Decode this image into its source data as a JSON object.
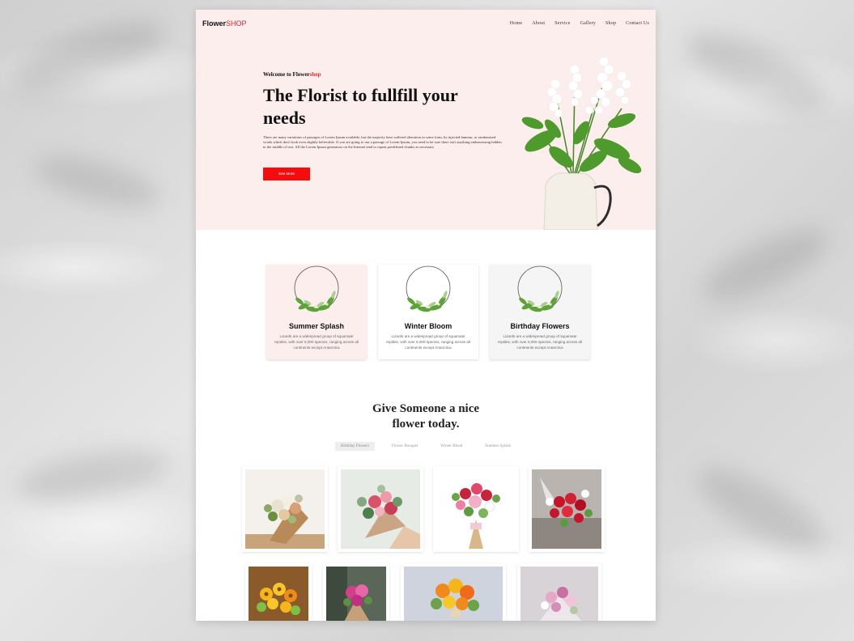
{
  "brand": {
    "name_black": "Flower",
    "name_red": "SHOP"
  },
  "nav": [
    "Home",
    "About",
    "Service",
    "Gallery",
    "Shop",
    "Contact Us"
  ],
  "hero": {
    "welcome_black": "Welcome to Flower",
    "welcome_red": "shop",
    "headline": "The Florist to fullfill your needs",
    "body": "There are many variations of passages of Lorem Ipsum available, but the majority have suffered alteration in some form, by injected humour, or randomised words which don't look even slightly believable. If you are going to use a passage of Lorem Ipsum, you need to be sure there isn't anything embarrassing hidden in the middle of text. All the Lorem Ipsum generators on the Internet tend to repeat predefined chunks as necessary",
    "button": "See More"
  },
  "features": [
    {
      "title": "Summer Splash",
      "text": "Lizards are a widespread group of squamate reptiles, with over 6,000 species, ranging across all continents except Antarctica"
    },
    {
      "title": "Winter Bloom",
      "text": "Lizards are a widespread group of squamate reptiles, with over 6,000 species, ranging across all continents except Antarctica"
    },
    {
      "title": "Birthday Flowers",
      "text": "Lizards are a widespread group of squamate reptiles, with over 6,000 species, ranging across all continents except Antarctica"
    }
  ],
  "gallery": {
    "title_line1": "Give Someone a nice",
    "title_line2": "flower today.",
    "filters": [
      "Birthday Flowers",
      "Flower Bouquet",
      "Winter Blood",
      "Summer Splash"
    ],
    "active_filter": "Birthday Flowers"
  },
  "colors": {
    "accent": "#f50c0c",
    "hero_bg": "#fdeeee"
  }
}
